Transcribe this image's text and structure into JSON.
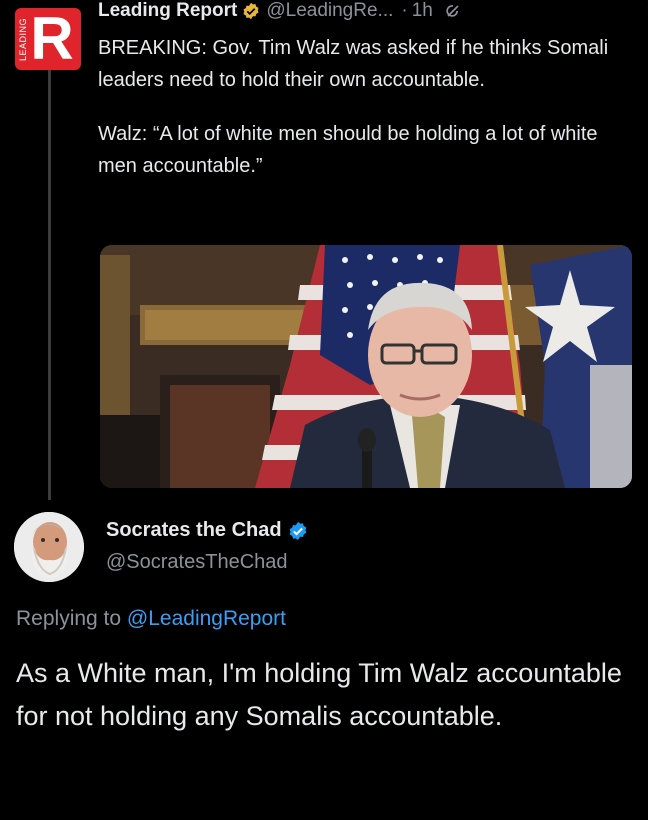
{
  "tweet": {
    "avatar_letter": "R",
    "avatar_side_text": "LEADING",
    "author_name": "Leading Report",
    "author_handle": "@LeadingRe...",
    "separator": "·",
    "time": "1h",
    "body_p1": "BREAKING: Gov. Tim Walz was asked if he thinks Somali leaders need to hold their own accountable.",
    "body_p2": "Walz: “A lot of white men should be holding a lot of white men accountable.”",
    "icons": [
      "verified-gold-icon",
      "grok-icon",
      "more-icon"
    ]
  },
  "reply": {
    "author_name": "Socrates the Chad",
    "author_handle": "@SocratesTheChad",
    "replying_prefix": "Replying to",
    "replying_mention": "@LeadingReport",
    "body": "As a White man, I'm holding Tim Walz accountable for not holding any Somalis accountable.",
    "icons": [
      "verified-blue-icon"
    ]
  },
  "colors": {
    "background": "#000000",
    "text": "#e7e9ea",
    "muted": "#8b9299",
    "link": "#3a9ef5",
    "brand_red": "#e0242b",
    "verified_gold": "#e8b53d",
    "verified_blue": "#1d9bf0"
  }
}
